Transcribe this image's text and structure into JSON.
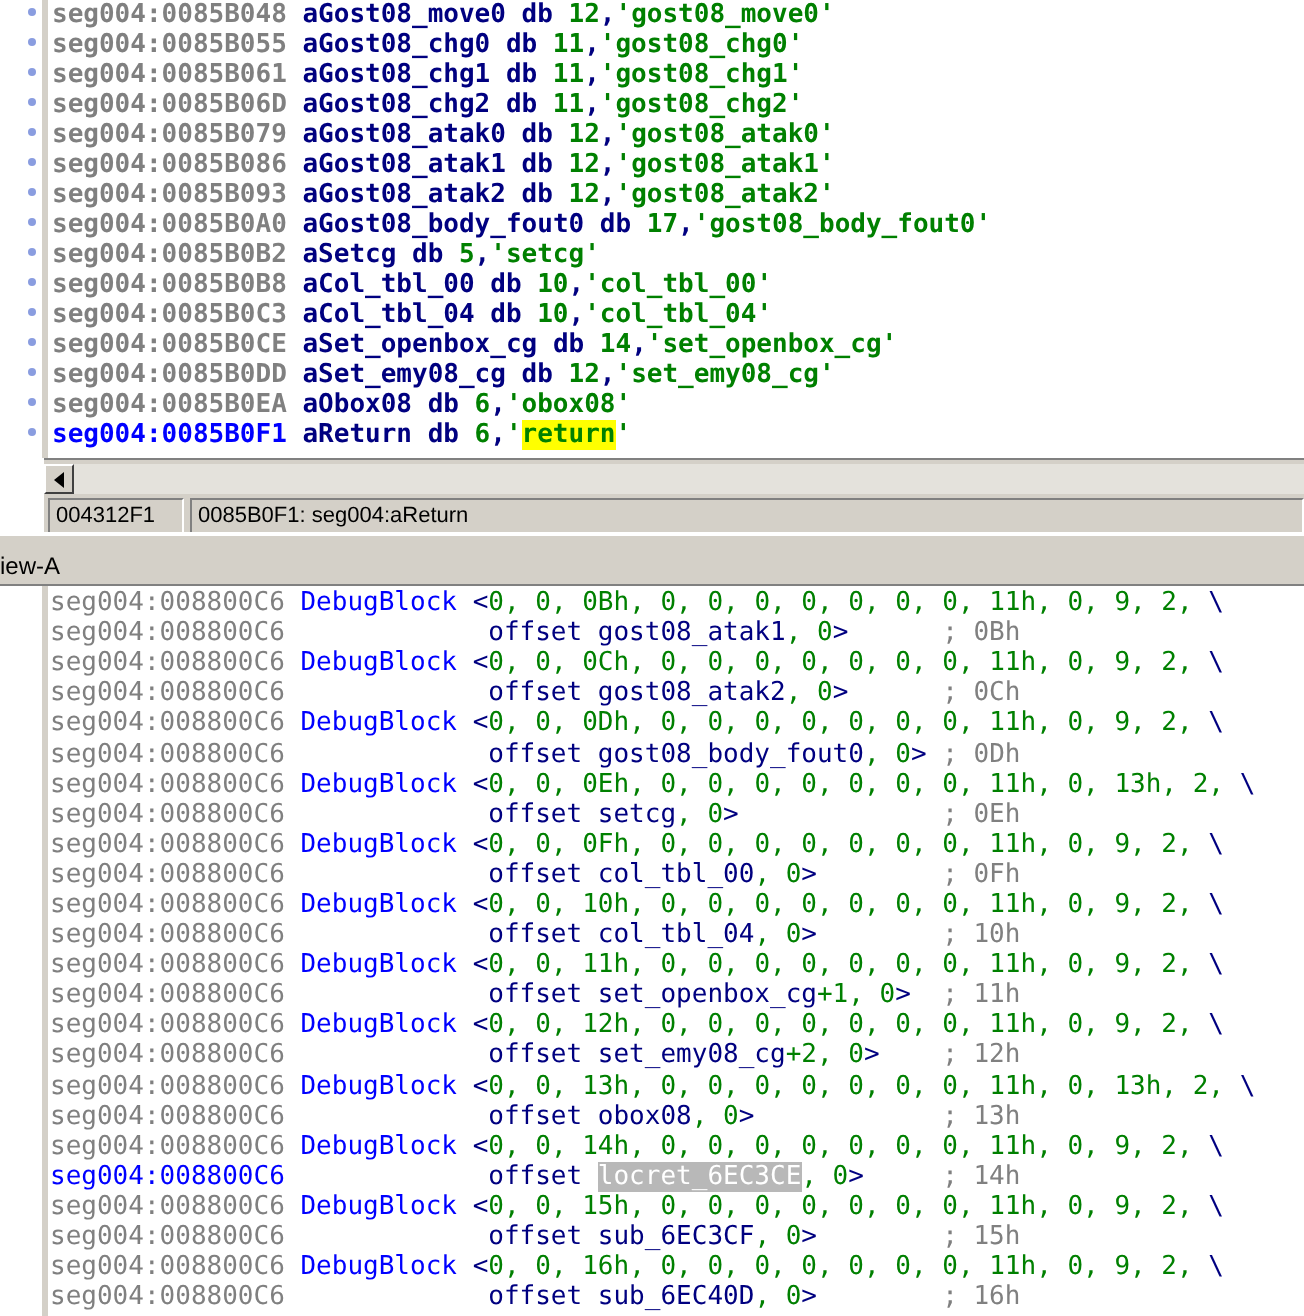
{
  "top_listing": {
    "lines": [
      {
        "address": "seg004:0085B048",
        "label": "aGost08_move0",
        "directive": "db",
        "value": "12,'gost08_move0'",
        "current": false,
        "highlighted": false
      },
      {
        "address": "seg004:0085B055",
        "label": "aGost08_chg0",
        "directive": "db",
        "value": "11,'gost08_chg0'",
        "current": false,
        "highlighted": false
      },
      {
        "address": "seg004:0085B061",
        "label": "aGost08_chg1",
        "directive": "db",
        "value": "11,'gost08_chg1'",
        "current": false,
        "highlighted": false
      },
      {
        "address": "seg004:0085B06D",
        "label": "aGost08_chg2",
        "directive": "db",
        "value": "11,'gost08_chg2'",
        "current": false,
        "highlighted": false
      },
      {
        "address": "seg004:0085B079",
        "label": "aGost08_atak0",
        "directive": "db",
        "value": "12,'gost08_atak0'",
        "current": false,
        "highlighted": false
      },
      {
        "address": "seg004:0085B086",
        "label": "aGost08_atak1",
        "directive": "db",
        "value": "12,'gost08_atak1'",
        "current": false,
        "highlighted": false
      },
      {
        "address": "seg004:0085B093",
        "label": "aGost08_atak2",
        "directive": "db",
        "value": "12,'gost08_atak2'",
        "current": false,
        "highlighted": false
      },
      {
        "address": "seg004:0085B0A0",
        "label": "aGost08_body_fout0",
        "directive": "db",
        "value": "17,'gost08_body_fout0'",
        "current": false,
        "highlighted": false
      },
      {
        "address": "seg004:0085B0B2",
        "label": "aSetcg",
        "directive": "db",
        "value": "5,'setcg'",
        "current": false,
        "highlighted": false
      },
      {
        "address": "seg004:0085B0B8",
        "label": "aCol_tbl_00",
        "directive": "db",
        "value": "10,'col_tbl_00'",
        "current": false,
        "highlighted": false
      },
      {
        "address": "seg004:0085B0C3",
        "label": "aCol_tbl_04",
        "directive": "db",
        "value": "10,'col_tbl_04'",
        "current": false,
        "highlighted": false
      },
      {
        "address": "seg004:0085B0CE",
        "label": "aSet_openbox_cg",
        "directive": "db",
        "value": "14,'set_openbox_cg'",
        "current": false,
        "highlighted": false
      },
      {
        "address": "seg004:0085B0DD",
        "label": "aSet_emy08_cg",
        "directive": "db",
        "value": "12,'set_emy08_cg'",
        "current": false,
        "highlighted": false
      },
      {
        "address": "seg004:0085B0EA",
        "label": "aObox08",
        "directive": "db",
        "value": "6,'obox08'",
        "current": false,
        "highlighted": false
      },
      {
        "address": "seg004:0085B0F1",
        "label": "aReturn",
        "directive": "db",
        "value": "6,'return'",
        "current": true,
        "highlighted": true
      }
    ]
  },
  "status_bar": {
    "offset": "004312F1",
    "location": "0085B0F1: seg004:aReturn"
  },
  "view_tab": {
    "title": "iew-A"
  },
  "bottom_listing": {
    "lines": [
      {
        "kind": "directive",
        "address": "seg004:008800C6",
        "mnemonic": "DebugBlock",
        "operands": "<0, 0, 0Bh, 0, 0, 0, 0, 0, 0, 0, 11h, 0, 9, 2, \\",
        "current": false
      },
      {
        "kind": "continuation",
        "address": "seg004:008800C6",
        "mnemonic": "offset",
        "symbol": "gost08_atak1",
        "tail": ", 0>",
        "comment": "; 0Bh",
        "current": false,
        "highlighted": false
      },
      {
        "kind": "directive",
        "address": "seg004:008800C6",
        "mnemonic": "DebugBlock",
        "operands": "<0, 0, 0Ch, 0, 0, 0, 0, 0, 0, 0, 11h, 0, 9, 2, \\",
        "current": false
      },
      {
        "kind": "continuation",
        "address": "seg004:008800C6",
        "mnemonic": "offset",
        "symbol": "gost08_atak2",
        "tail": ", 0>",
        "comment": "; 0Ch",
        "current": false,
        "highlighted": false
      },
      {
        "kind": "directive",
        "address": "seg004:008800C6",
        "mnemonic": "DebugBlock",
        "operands": "<0, 0, 0Dh, 0, 0, 0, 0, 0, 0, 0, 11h, 0, 9, 2, \\",
        "current": false
      },
      {
        "kind": "continuation",
        "address": "seg004:008800C6",
        "mnemonic": "offset",
        "symbol": "gost08_body_fout0",
        "tail": ", 0>",
        "comment": "; 0Dh",
        "current": false,
        "highlighted": false
      },
      {
        "kind": "directive",
        "address": "seg004:008800C6",
        "mnemonic": "DebugBlock",
        "operands": "<0, 0, 0Eh, 0, 0, 0, 0, 0, 0, 0, 11h, 0, 13h, 2, \\",
        "current": false
      },
      {
        "kind": "continuation",
        "address": "seg004:008800C6",
        "mnemonic": "offset",
        "symbol": "setcg",
        "tail": ", 0>",
        "comment": "; 0Eh",
        "current": false,
        "highlighted": false
      },
      {
        "kind": "directive",
        "address": "seg004:008800C6",
        "mnemonic": "DebugBlock",
        "operands": "<0, 0, 0Fh, 0, 0, 0, 0, 0, 0, 0, 11h, 0, 9, 2, \\",
        "current": false
      },
      {
        "kind": "continuation",
        "address": "seg004:008800C6",
        "mnemonic": "offset",
        "symbol": "col_tbl_00",
        "tail": ", 0>",
        "comment": "; 0Fh",
        "current": false,
        "highlighted": false
      },
      {
        "kind": "directive",
        "address": "seg004:008800C6",
        "mnemonic": "DebugBlock",
        "operands": "<0, 0, 10h, 0, 0, 0, 0, 0, 0, 0, 11h, 0, 9, 2, \\",
        "current": false
      },
      {
        "kind": "continuation",
        "address": "seg004:008800C6",
        "mnemonic": "offset",
        "symbol": "col_tbl_04",
        "tail": ", 0>",
        "comment": "; 10h",
        "current": false,
        "highlighted": false
      },
      {
        "kind": "directive",
        "address": "seg004:008800C6",
        "mnemonic": "DebugBlock",
        "operands": "<0, 0, 11h, 0, 0, 0, 0, 0, 0, 0, 11h, 0, 9, 2, \\",
        "current": false
      },
      {
        "kind": "continuation",
        "address": "seg004:008800C6",
        "mnemonic": "offset",
        "symbol": "set_openbox_cg",
        "displacement": "+1",
        "tail": ", 0>",
        "comment": "; 11h",
        "current": false,
        "highlighted": false
      },
      {
        "kind": "directive",
        "address": "seg004:008800C6",
        "mnemonic": "DebugBlock",
        "operands": "<0, 0, 12h, 0, 0, 0, 0, 0, 0, 0, 11h, 0, 9, 2, \\",
        "current": false
      },
      {
        "kind": "continuation",
        "address": "seg004:008800C6",
        "mnemonic": "offset",
        "symbol": "set_emy08_cg",
        "displacement": "+2",
        "tail": ", 0>",
        "comment": "; 12h",
        "current": false,
        "highlighted": false
      },
      {
        "kind": "directive",
        "address": "seg004:008800C6",
        "mnemonic": "DebugBlock",
        "operands": "<0, 0, 13h, 0, 0, 0, 0, 0, 0, 0, 11h, 0, 13h, 2, \\",
        "current": false
      },
      {
        "kind": "continuation",
        "address": "seg004:008800C6",
        "mnemonic": "offset",
        "symbol": "obox08",
        "tail": ", 0>",
        "comment": "; 13h",
        "current": false,
        "highlighted": false
      },
      {
        "kind": "directive",
        "address": "seg004:008800C6",
        "mnemonic": "DebugBlock",
        "operands": "<0, 0, 14h, 0, 0, 0, 0, 0, 0, 0, 11h, 0, 9, 2, \\",
        "current": false
      },
      {
        "kind": "continuation",
        "address": "seg004:008800C6",
        "mnemonic": "offset",
        "symbol": "locret_6EC3CE",
        "tail": ", 0>",
        "comment": "; 14h",
        "current": true,
        "highlighted": true
      },
      {
        "kind": "directive",
        "address": "seg004:008800C6",
        "mnemonic": "DebugBlock",
        "operands": "<0, 0, 15h, 0, 0, 0, 0, 0, 0, 0, 11h, 0, 9, 2, \\",
        "current": false
      },
      {
        "kind": "continuation",
        "address": "seg004:008800C6",
        "mnemonic": "offset",
        "symbol": "sub_6EC3CF",
        "tail": ", 0>",
        "comment": "; 15h",
        "current": false,
        "highlighted": false
      },
      {
        "kind": "directive",
        "address": "seg004:008800C6",
        "mnemonic": "DebugBlock",
        "operands": "<0, 0, 16h, 0, 0, 0, 0, 0, 0, 0, 11h, 0, 9, 2, \\",
        "current": false
      },
      {
        "kind": "continuation",
        "address": "seg004:008800C6",
        "mnemonic": "offset",
        "symbol": "sub_6EC40D",
        "tail": ", 0>",
        "comment": "; 16h",
        "current": false,
        "highlighted": false
      }
    ]
  }
}
